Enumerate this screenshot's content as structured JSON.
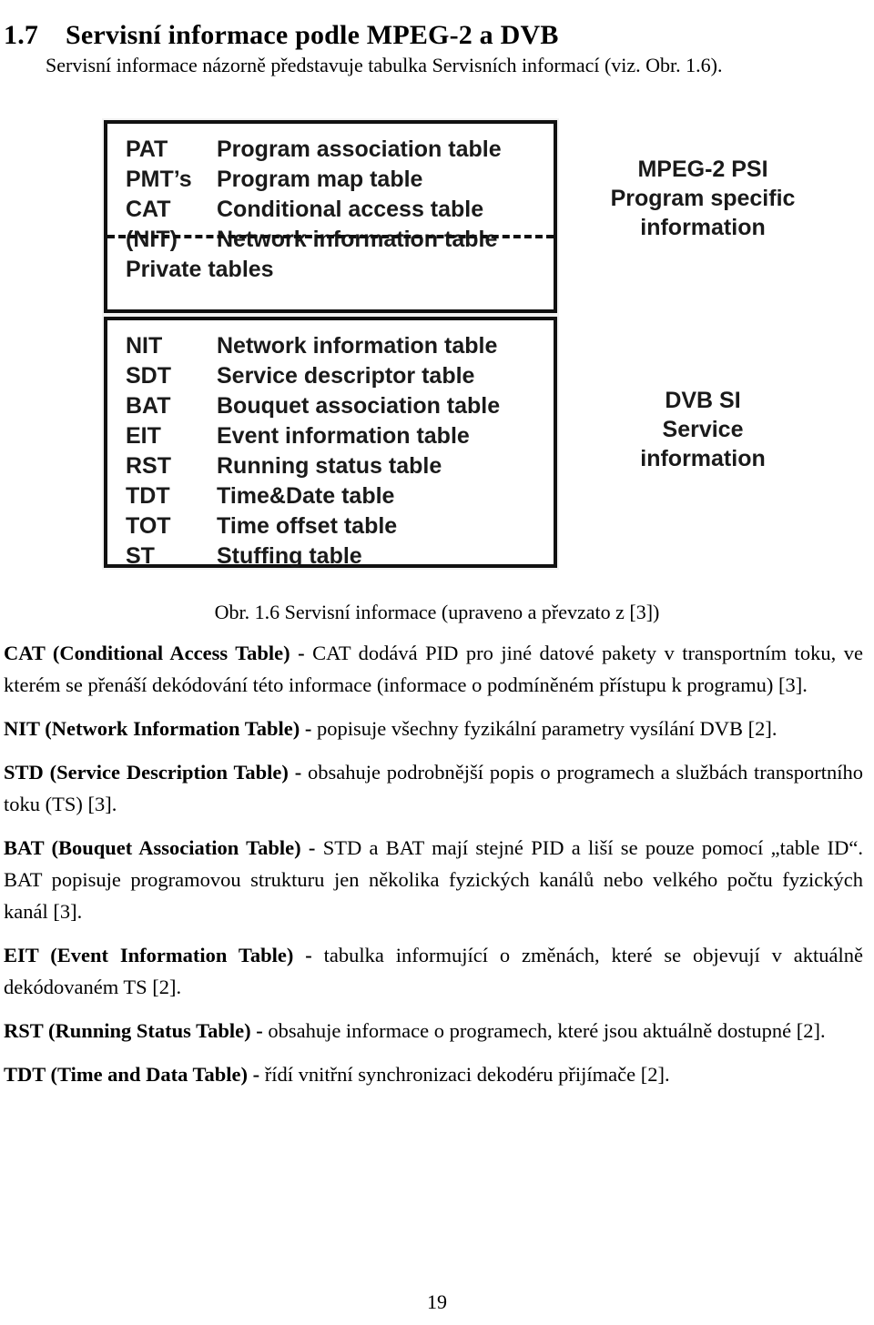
{
  "heading": {
    "number": "1.7",
    "title": "Servisní informace podle MPEG-2 a DVB"
  },
  "intro": {
    "text": "Servisní informace názorně představuje tabulka Servisních informací (viz. Obr. 1.6)."
  },
  "figure": {
    "caption": "Obr. 1.6 Servisní informace (upraveno a převzato z [3])",
    "top_box": {
      "rows": [
        {
          "abbr": "PAT",
          "name": "Program association table"
        },
        {
          "abbr": "PMT’s",
          "name": "Program map table"
        },
        {
          "abbr": "CAT",
          "name": "Conditional access table"
        },
        {
          "abbr": "(NIT)",
          "name": "Network information table"
        },
        {
          "abbr": "Private tables",
          "name": ""
        }
      ],
      "side_label_line1": "MPEG-2 PSI",
      "side_label_line2": "Program specific",
      "side_label_line3": "information"
    },
    "bottom_box": {
      "rows": [
        {
          "abbr": "NIT",
          "name": "Network information table"
        },
        {
          "abbr": "SDT",
          "name": "Service descriptor table"
        },
        {
          "abbr": "BAT",
          "name": "Bouquet association table"
        },
        {
          "abbr": "EIT",
          "name": "Event information table"
        },
        {
          "abbr": "RST",
          "name": "Running status table"
        },
        {
          "abbr": "TDT",
          "name": "Time&Date table"
        },
        {
          "abbr": "TOT",
          "name": "Time offset table"
        },
        {
          "abbr": "ST",
          "name": "Stuffing table"
        }
      ],
      "side_label_line1": "DVB SI",
      "side_label_line2": "Service",
      "side_label_line3": "information"
    }
  },
  "paragraphs": [
    {
      "term": "CAT (Conditional Access Table) - ",
      "body": "CAT dodává PID pro jiné datové pakety v transportním toku, ve kterém se přenáší dekódování této informace (informace o podmíněném přístupu k programu) [3]."
    },
    {
      "term": "NIT (Network Information Table) - ",
      "body": "popisuje všechny fyzikální parametry vysílání DVB [2]."
    },
    {
      "term": "STD (Service Description Table) - ",
      "body": "obsahuje podrobnější popis o programech a službách transportního toku (TS) [3]."
    },
    {
      "term": "BAT (Bouquet Association Table) - ",
      "body": "STD a BAT mají stejné PID a liší se pouze pomocí „table ID“. BAT popisuje programovou strukturu jen několika fyzických kanálů nebo velkého počtu fyzických kanál [3]."
    },
    {
      "term": "EIT (Event Information Table) - ",
      "body": "tabulka informující o změnách, které se objevují v aktuálně dekódovaném TS [2]."
    },
    {
      "term": "RST (Running Status Table) - ",
      "body": "obsahuje informace o programech, které jsou aktuálně dostupné [2]."
    },
    {
      "term": "TDT (Time and Data Table) - ",
      "body": "řídí vnitřní synchronizaci dekodéru přijímače [2]."
    }
  ],
  "footer": {
    "page_number": "19"
  }
}
